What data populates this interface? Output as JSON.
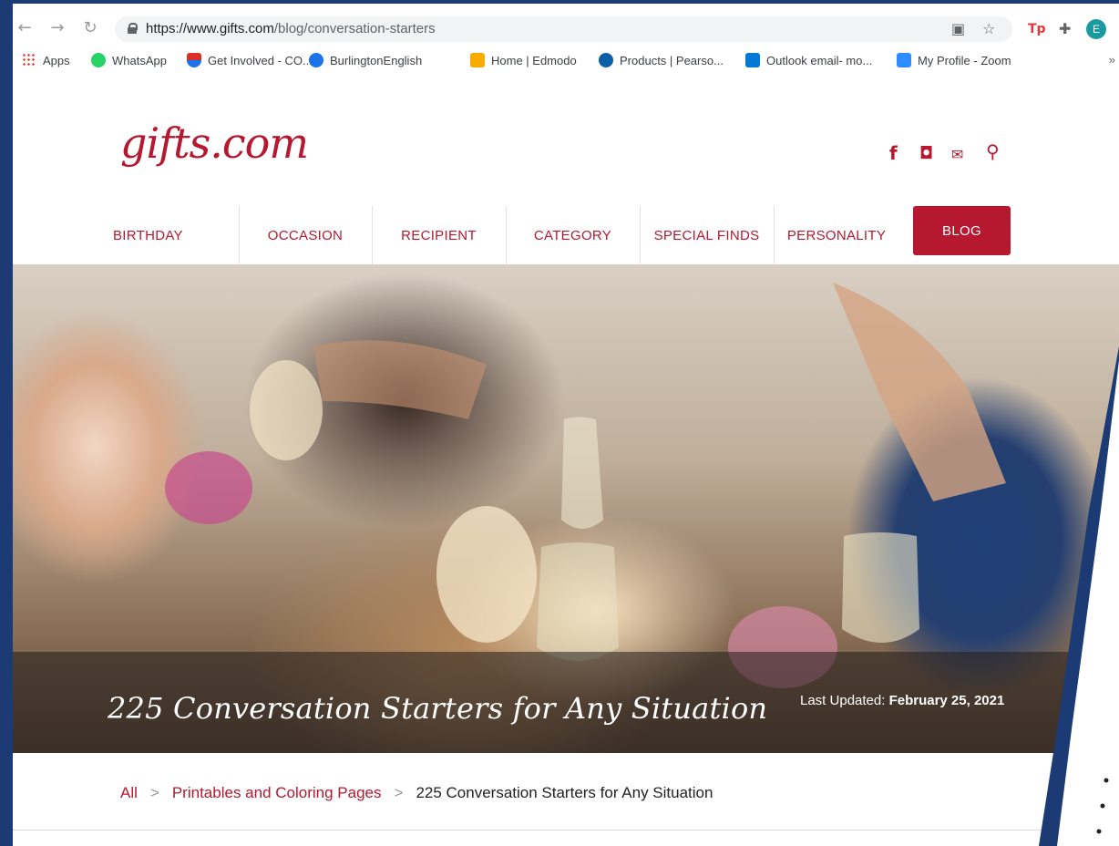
{
  "browser": {
    "url_host": "https://www.gifts.com",
    "url_path": "/blog/conversation-starters",
    "bookmarks": [
      {
        "label": "Apps",
        "color": "#4285f4"
      },
      {
        "label": "WhatsApp",
        "color": "#25d366"
      },
      {
        "label": "Get Involved - CO...",
        "color": "#d93025"
      },
      {
        "label": "BurlingtonEnglish",
        "color": "#1a73e8"
      },
      {
        "label": "Home | Edmodo",
        "color": "#f9ab00"
      },
      {
        "label": "Products | Pearso...",
        "color": "#0b5ea8"
      },
      {
        "label": "Outlook email- mo...",
        "color": "#0078d4"
      },
      {
        "label": "My Profile - Zoom",
        "color": "#2d8cff"
      }
    ],
    "more": "»",
    "avatar_letter": "E",
    "ext_tp": "Tp"
  },
  "site": {
    "logo": "gifts.com",
    "brand_color": "#b5182f",
    "menu": [
      "BIRTHDAY",
      "OCCASION",
      "RECIPIENT",
      "CATEGORY",
      "SPECIAL FINDS",
      "PERSONALITY"
    ],
    "menu_active": "BLOG",
    "hero_title": "225 Conversation Starters for Any Situation",
    "last_updated_label": "Last Updated:",
    "last_updated_date": "February 25, 2021",
    "breadcrumb": {
      "all": "All",
      "category": "Printables and Coloring Pages",
      "current": "225 Conversation Starters for Any Situation",
      "separator": ">"
    }
  }
}
